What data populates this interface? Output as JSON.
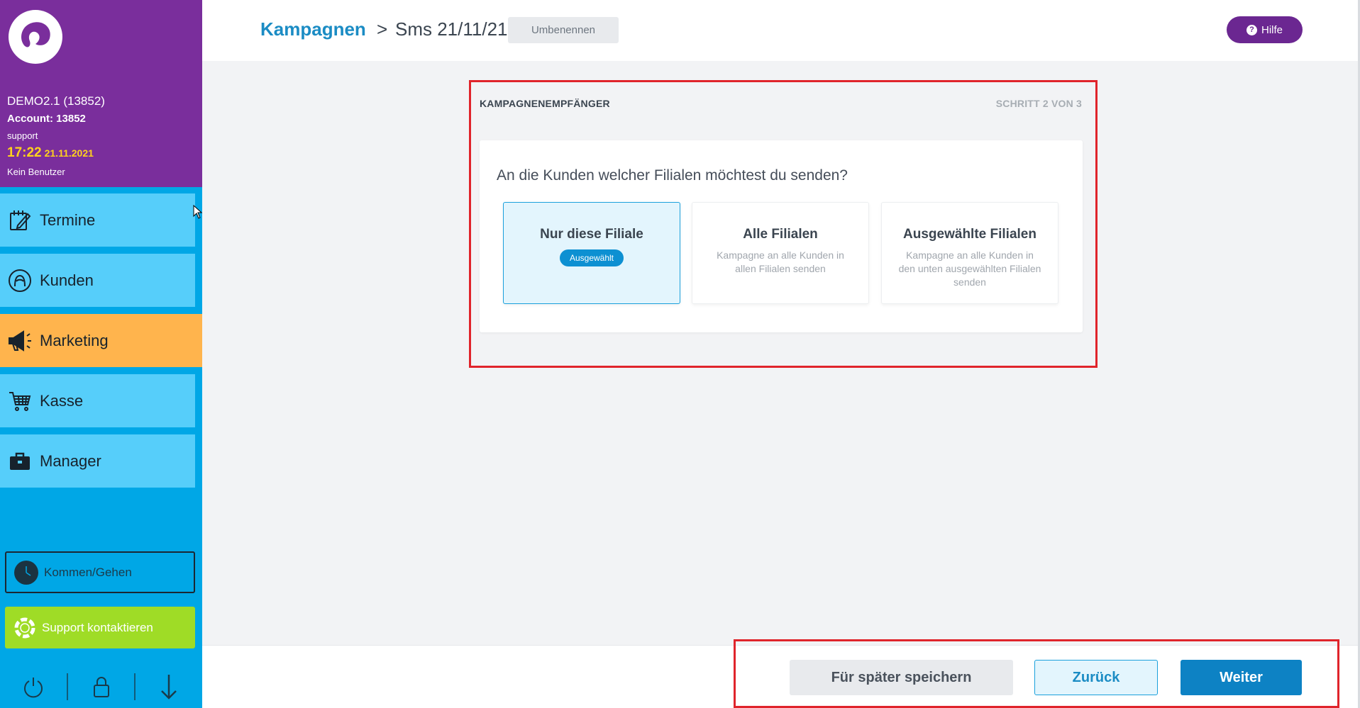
{
  "account": {
    "name": "DEMO2.1 (13852)",
    "number": "Account: 13852",
    "role": "support",
    "time": "17:22",
    "date": "21.11.2021",
    "user": "Kein Benutzer"
  },
  "nav": {
    "items": [
      {
        "label": "Termine",
        "icon": "calendar-edit-icon",
        "active": false
      },
      {
        "label": "Kunden",
        "icon": "customer-icon",
        "active": false
      },
      {
        "label": "Marketing",
        "icon": "megaphone-icon",
        "active": true
      },
      {
        "label": "Kasse",
        "icon": "cart-icon",
        "active": false
      },
      {
        "label": "Manager",
        "icon": "briefcase-icon",
        "active": false
      }
    ]
  },
  "sidebar_buttons": {
    "clock_label": "Kommen/Gehen",
    "support_label": "Support kontaktieren"
  },
  "system_icons": [
    "power-icon",
    "lock-icon",
    "download-arrow-icon"
  ],
  "header": {
    "breadcrumb_link": "Kampagnen",
    "breadcrumb_separator": ">",
    "breadcrumb_current": "Sms 21/11/21",
    "rename_label": "Umbenennen",
    "help_label": "Hilfe"
  },
  "panel": {
    "title": "KAMPAGNENEMPFÄNGER",
    "step": "SCHRITT 2 VON 3",
    "question": "An die Kunden welcher Filialen möchtest du senden?",
    "options": [
      {
        "title": "Nur diese Filiale",
        "badge": "Ausgewählt",
        "selected": true
      },
      {
        "title": "Alle Filialen",
        "description": "Kampagne an alle Kunden in allen Filialen senden",
        "selected": false
      },
      {
        "title": "Ausgewählte Filialen",
        "description": "Kampagne an alle Kunden in den unten ausgewählten Filialen senden",
        "selected": false
      }
    ]
  },
  "footer": {
    "save_later_label": "Für später speichern",
    "back_label": "Zurück",
    "next_label": "Weiter"
  },
  "colors": {
    "sidebar_purple": "#7a2e9c",
    "sidebar_blue": "#00a7e6",
    "nav_item": "#56cefa",
    "nav_active": "#ffb44d",
    "time_yellow": "#ffd21c",
    "support_green": "#9fdc26",
    "accent_blue": "#0d82c4",
    "help_purple": "#6b2791",
    "highlight_red": "#e0242b"
  }
}
